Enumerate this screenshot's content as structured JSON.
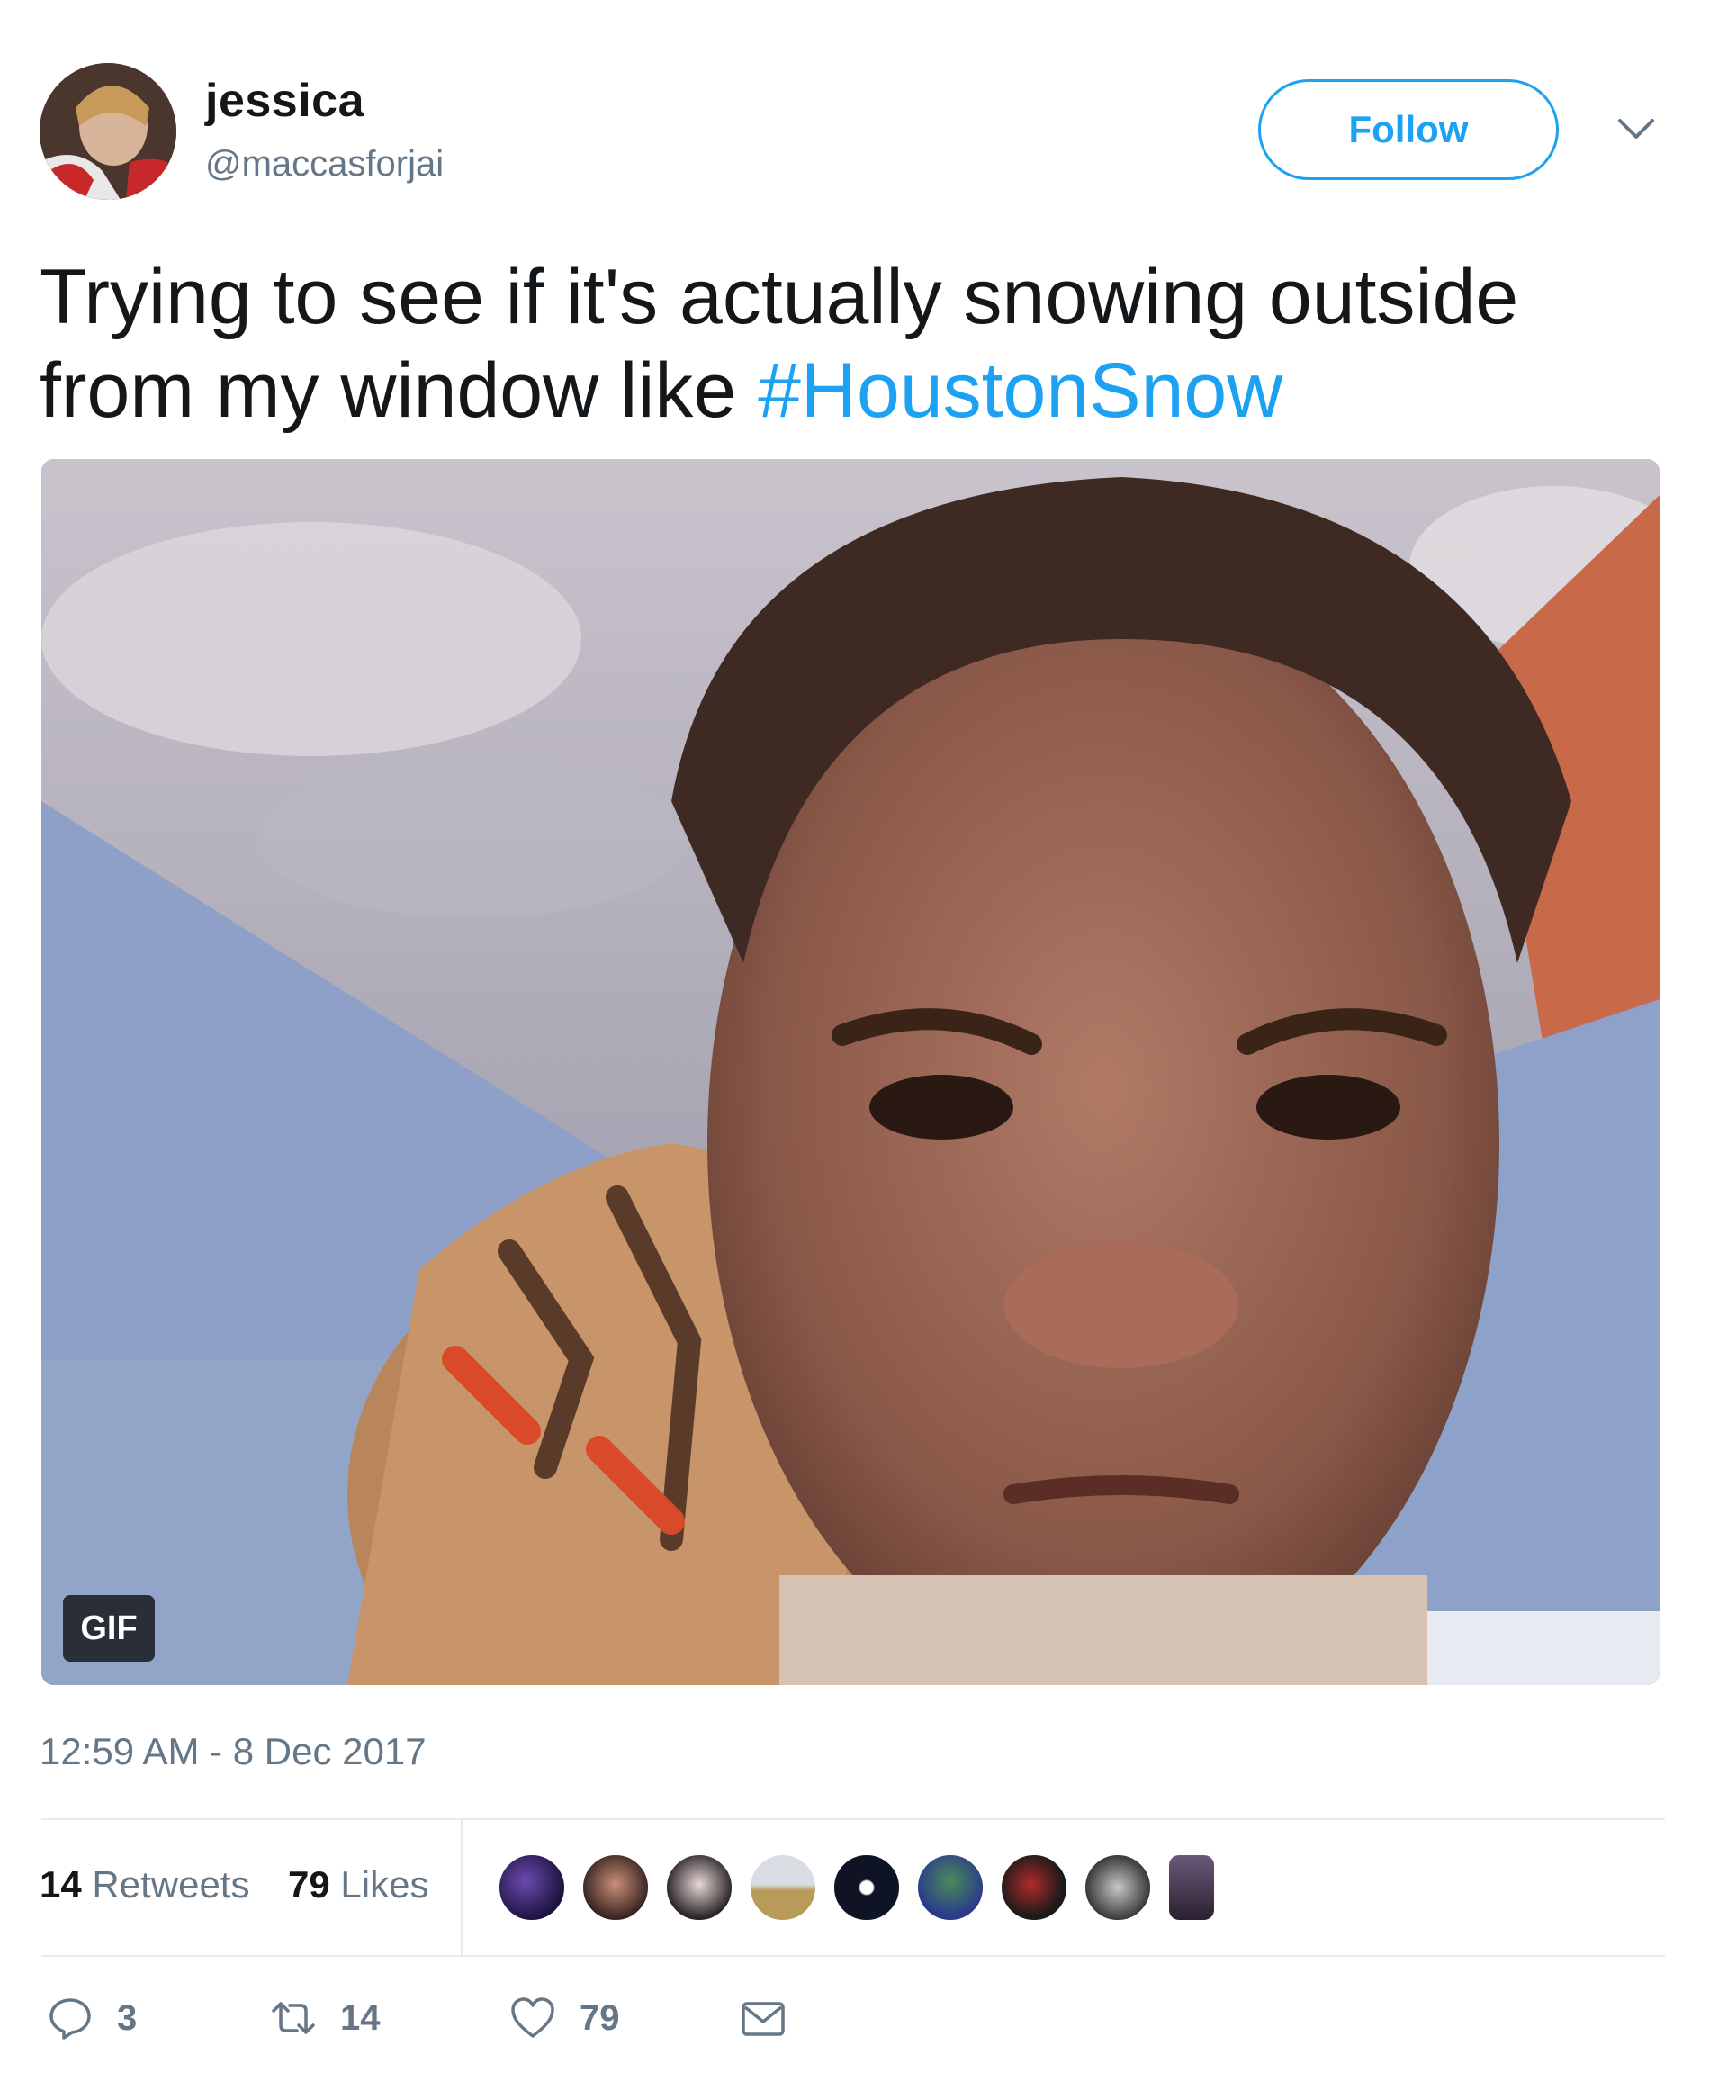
{
  "user": {
    "display_name": "jessica",
    "handle": "@maccasforjai",
    "avatar_icon": "user-avatar"
  },
  "follow_label": "Follow",
  "menu_icon": "chevron-down-icon",
  "tweet": {
    "text": "Trying to see if it's actually snowing outside from my window like ",
    "hashtag": "#HoustonSnow"
  },
  "media": {
    "badge": "GIF"
  },
  "timestamp": "12:59 AM - 8 Dec 2017",
  "stats": {
    "retweets_count": "14",
    "retweets_label": "Retweets",
    "likes_count": "79",
    "likes_label": "Likes"
  },
  "liker_count": 9,
  "actions": {
    "reply_count": "3",
    "retweet_count": "14",
    "like_count": "79"
  },
  "colors": {
    "accent": "#1da1f2",
    "secondary_text": "#657786",
    "primary_text": "#14171a"
  }
}
